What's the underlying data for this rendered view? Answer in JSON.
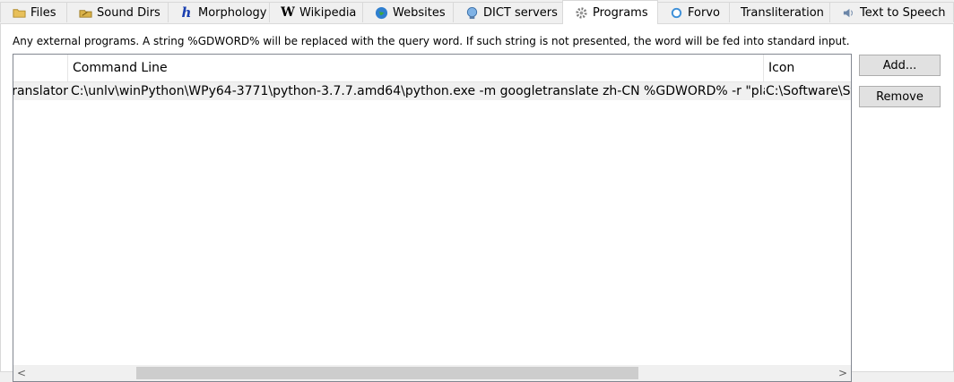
{
  "tabs": [
    {
      "label": "Files",
      "icon": "folder-icon"
    },
    {
      "label": "Sound Dirs",
      "icon": "sound-folder-icon"
    },
    {
      "label": "Morphology",
      "icon": "morphology-h-icon"
    },
    {
      "label": "Wikipedia",
      "icon": "wikipedia-w-icon"
    },
    {
      "label": "Websites",
      "icon": "globe-icon"
    },
    {
      "label": "DICT servers",
      "icon": "network-icon"
    },
    {
      "label": "Programs",
      "icon": "gear-icon",
      "active": true
    },
    {
      "label": "Forvo",
      "icon": "forvo-icon"
    },
    {
      "label": "Transliteration",
      "icon": ""
    },
    {
      "label": "Text to Speech",
      "icon": "speaker-icon"
    }
  ],
  "programs": {
    "description": "Any external programs. A string %GDWORD% will be replaced with the query word. If such string is not presented, the word will be fed into standard input.",
    "columns": {
      "name": "",
      "command": "Command Line",
      "icon": "Icon"
    },
    "rows": [
      {
        "name": "ranslator",
        "command": "C:\\unlv\\winPython\\WPy64-3771\\python-3.7.7.amd64\\python.exe -m googletranslate zh-CN %GDWORD% -r \"plain\"",
        "icon": "C:\\Software\\St"
      }
    ],
    "scrollbar": {
      "left_arrow": "<",
      "right_arrow": ">"
    },
    "buttons": {
      "add": "Add...",
      "remove": "Remove"
    }
  }
}
